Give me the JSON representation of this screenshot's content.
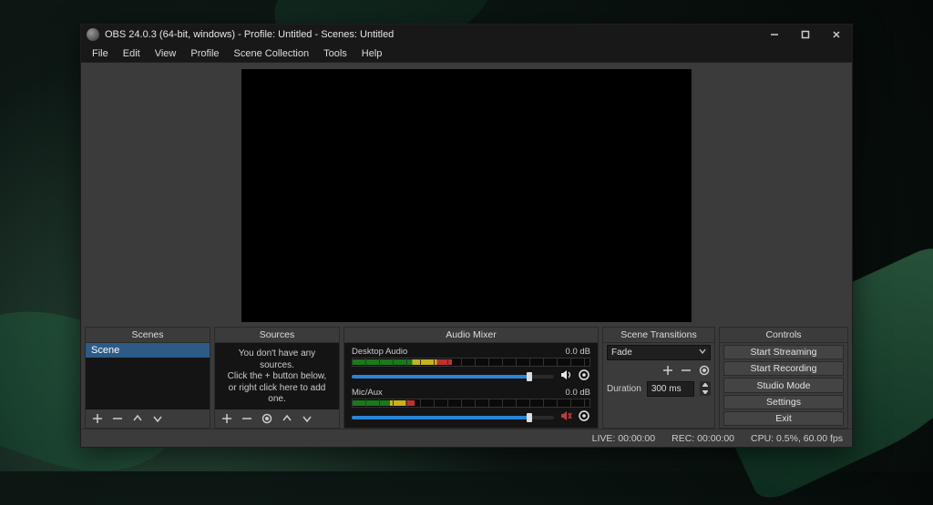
{
  "window": {
    "title": "OBS 24.0.3 (64-bit, windows) - Profile: Untitled - Scenes: Untitled"
  },
  "menu": {
    "file": "File",
    "edit": "Edit",
    "view": "View",
    "profile": "Profile",
    "scene_collection": "Scene Collection",
    "tools": "Tools",
    "help": "Help"
  },
  "docks": {
    "scenes": {
      "title": "Scenes",
      "items": [
        "Scene"
      ]
    },
    "sources": {
      "title": "Sources",
      "hint_line1": "You don't have any sources.",
      "hint_line2": "Click the + button below,",
      "hint_line3": "or right click here to add one."
    },
    "mixer": {
      "title": "Audio Mixer",
      "channels": [
        {
          "name": "Desktop Audio",
          "level": "0.0 dB"
        },
        {
          "name": "Mic/Aux",
          "level": "0.0 dB"
        }
      ]
    },
    "transitions": {
      "title": "Scene Transitions",
      "selected": "Fade",
      "duration_label": "Duration",
      "duration_value": "300 ms"
    },
    "controls": {
      "title": "Controls",
      "buttons": {
        "start_streaming": "Start Streaming",
        "start_recording": "Start Recording",
        "studio_mode": "Studio Mode",
        "settings": "Settings",
        "exit": "Exit"
      }
    }
  },
  "status": {
    "live": "LIVE: 00:00:00",
    "rec": "REC: 00:00:00",
    "cpu": "CPU: 0.5%, 60.00 fps"
  }
}
